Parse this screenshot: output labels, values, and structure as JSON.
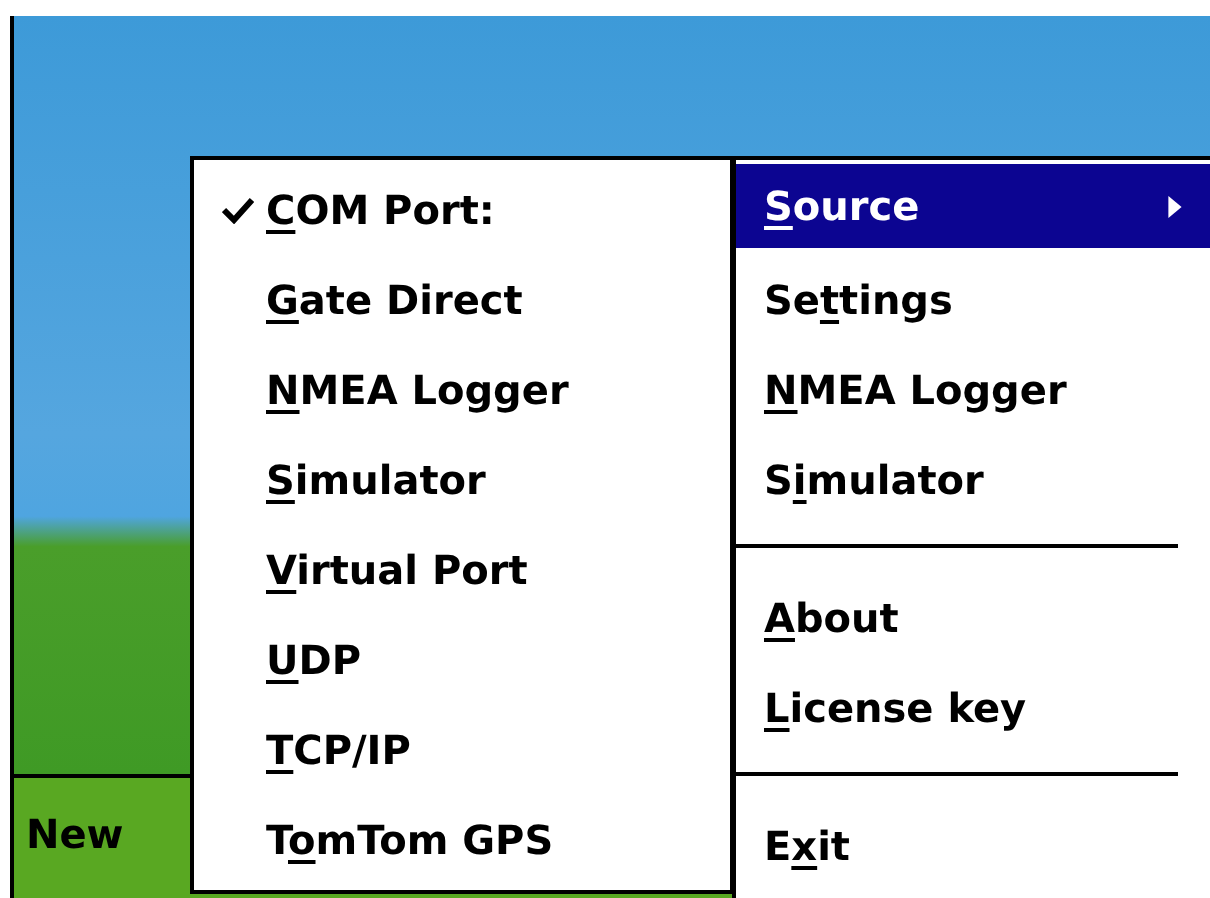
{
  "softkey_bar": {
    "left_softkey": "New"
  },
  "main_menu": {
    "items": [
      {
        "kind": "item",
        "key": "S",
        "post": "ource",
        "selected": true,
        "has_submenu": true
      },
      {
        "kind": "item",
        "pre": "Se",
        "key": "t",
        "post": "tings",
        "selected": false,
        "has_submenu": false
      },
      {
        "kind": "item",
        "key": "N",
        "post": "MEA Logger",
        "selected": false,
        "has_submenu": false
      },
      {
        "kind": "item",
        "pre": "S",
        "key": "i",
        "post": "mulator",
        "selected": false,
        "has_submenu": false
      },
      {
        "kind": "separator"
      },
      {
        "kind": "item",
        "key": "A",
        "post": "bout",
        "selected": false,
        "has_submenu": false
      },
      {
        "kind": "item",
        "key": "L",
        "post": "icense key",
        "selected": false,
        "has_submenu": false
      },
      {
        "kind": "separator"
      },
      {
        "kind": "item",
        "pre": "E",
        "key": "x",
        "post": "it",
        "selected": false,
        "has_submenu": false
      }
    ]
  },
  "source_submenu": {
    "items": [
      {
        "key": "C",
        "post": "OM Port:",
        "checked": true
      },
      {
        "key": "G",
        "post": "ate Direct",
        "checked": false
      },
      {
        "key": "N",
        "post": "MEA Logger",
        "checked": false
      },
      {
        "key": "S",
        "post": "imulator",
        "checked": false
      },
      {
        "key": "V",
        "post": "irtual Port",
        "checked": false
      },
      {
        "key": "U",
        "post": "DP",
        "checked": false
      },
      {
        "key": "T",
        "post": "CP/IP",
        "checked": false
      },
      {
        "pre": "T",
        "key": "o",
        "post": "mTom GPS",
        "checked": false
      }
    ]
  }
}
